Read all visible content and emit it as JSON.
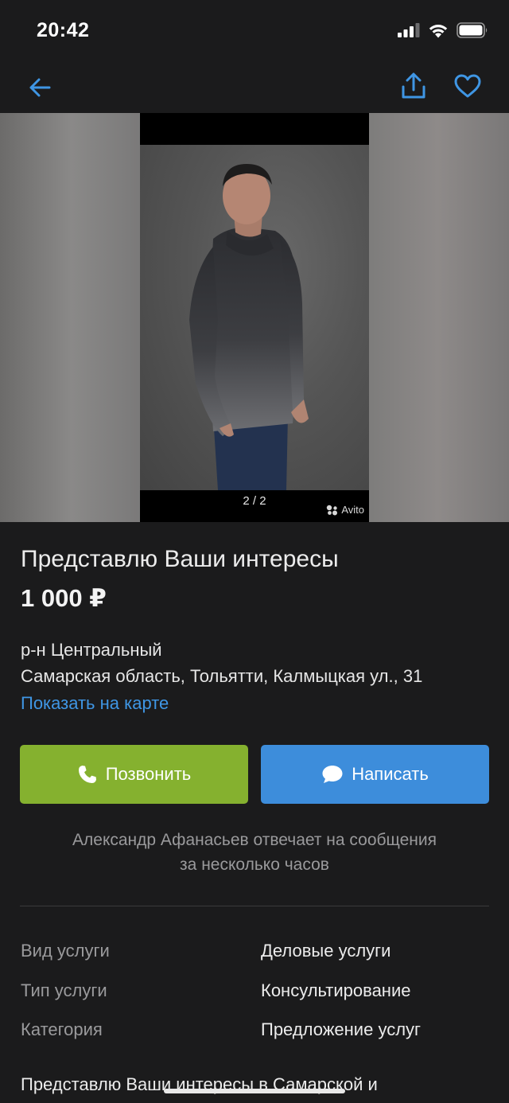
{
  "status_bar": {
    "time": "20:42"
  },
  "nav": {
    "back_icon": "arrow-left-icon",
    "share_icon": "share-icon",
    "favorite_icon": "heart-icon"
  },
  "gallery": {
    "counter": "2 / 2",
    "watermark": "Avito"
  },
  "listing": {
    "title": "Представлю Ваши интересы",
    "price": "1 000 ₽",
    "district": "р-н Центральный",
    "address": "Самарская область, Тольятти, Калмыцкая ул., 31",
    "map_link": "Показать на карте"
  },
  "actions": {
    "call_label": "Позвонить",
    "write_label": "Написать"
  },
  "seller_note": {
    "line1": "Александр Афанасьев отвечает на сообщения",
    "line2": "за несколько часов"
  },
  "params": [
    {
      "label": "Вид услуги",
      "value": "Деловые услуги"
    },
    {
      "label": "Тип услуги",
      "value": "Консультирование"
    },
    {
      "label": "Категория",
      "value": "Предложение услуг"
    }
  ],
  "description_preview": "Представлю Ваши интересы в Самарской и",
  "colors": {
    "background": "#1b1b1c",
    "accent_blue": "#3d8ddb",
    "link_blue": "#3f96e4",
    "call_green": "#85b12f",
    "muted_text": "#9a9a9c"
  }
}
